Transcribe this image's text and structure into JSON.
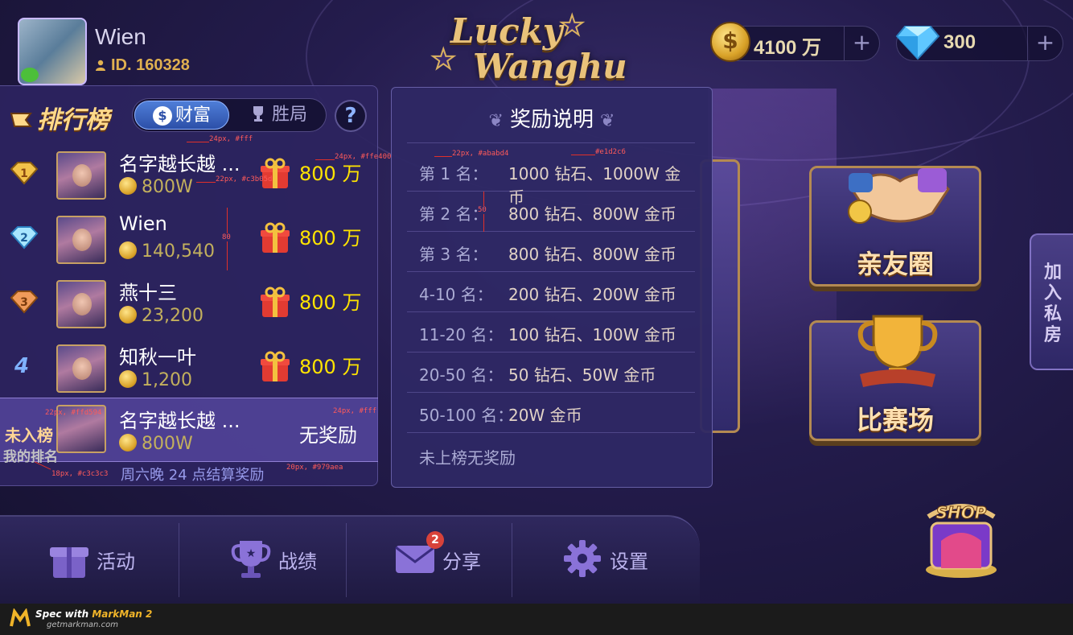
{
  "user": {
    "name": "Wien",
    "id_text": "ID. 160328"
  },
  "logo": {
    "line1": "Lucky",
    "line2": "Wanghu"
  },
  "resources": {
    "coins": {
      "amount": "4100 万",
      "plus": "+",
      "icon": "coin-icon"
    },
    "diamonds": {
      "amount": "300",
      "plus": "+",
      "icon": "diamond-icon"
    }
  },
  "leaderboard": {
    "title": "排行榜",
    "tabs": [
      {
        "label": "财富",
        "icon_glyph": "$",
        "active": true
      },
      {
        "label": "胜局",
        "active": false
      }
    ],
    "help": "?",
    "rows": [
      {
        "rank": "1",
        "name": "名字越长越 ...",
        "coins": "800W",
        "reward": "800 万"
      },
      {
        "rank": "2",
        "name": "Wien",
        "coins": "140,540",
        "reward": "800 万"
      },
      {
        "rank": "3",
        "name": "燕十三",
        "coins": "23,200",
        "reward": "800 万"
      },
      {
        "rank": "4",
        "name": "知秋一叶",
        "coins": "1,200",
        "reward": "800 万"
      }
    ],
    "mine": {
      "status": "未入榜",
      "label": "我的排名",
      "name": "名字越长越 ...",
      "coins": "800W",
      "reward": "无奖励"
    },
    "settle_note": "周六晚 24 点结算奖励"
  },
  "rewards_panel": {
    "title": "奖励说明",
    "items": [
      {
        "rank": "第 1 名：",
        "reward": "1000 钻石、1000W 金币"
      },
      {
        "rank": "第 2 名：",
        "reward": "800 钻石、800W 金币"
      },
      {
        "rank": "第 3 名：",
        "reward": "800 钻石、800W 金币"
      },
      {
        "rank": "4-10 名：",
        "reward": "200 钻石、200W 金币"
      },
      {
        "rank": "11-20 名：",
        "reward": "100 钻石、100W 金币"
      },
      {
        "rank": "20-50 名：",
        "reward": "50 钻石、50W 金币"
      },
      {
        "rank": "50-100 名：",
        "reward": "20W 金币"
      }
    ],
    "footer": "未上榜无奖励"
  },
  "cards": {
    "friends": "亲友圈",
    "arena": "比赛场",
    "private_room": "加入私房"
  },
  "nav": [
    {
      "label": "活动",
      "icon": "gift-icon"
    },
    {
      "label": "战绩",
      "icon": "trophy-icon"
    },
    {
      "label": "分享",
      "icon": "mail-icon",
      "badge": "2"
    },
    {
      "label": "设置",
      "icon": "gear-icon"
    }
  ],
  "shop": {
    "label": "SHOP"
  },
  "footer": {
    "spec": "Spec with",
    "brand": "MarkMan 2",
    "site": "getmarkman.com"
  },
  "annotations": {
    "a1": "24px, #fff",
    "a2": "24px, #ffe400",
    "a3": "22px, #c3b05d",
    "a4": "80",
    "a5": "22px, #ffd594",
    "a6": "24px, #fff",
    "a7": "18px, #c3c3c3",
    "a8": "20px, #979aea",
    "a9": "22px, #ababd4",
    "a10": "#e1d2c6",
    "a11": "50"
  },
  "colors": {
    "reward_yellow": "#ffe400",
    "coin_text": "#c3b05d",
    "rank_label": "#ababd4",
    "rank_value": "#e1d2c6",
    "note": "#979aea"
  }
}
